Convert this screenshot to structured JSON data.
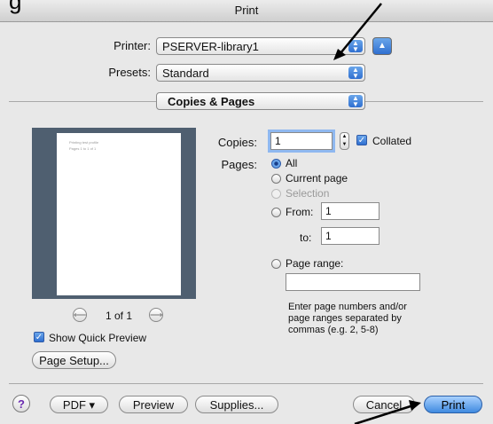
{
  "window": {
    "title": "Print",
    "title_fragment": "g"
  },
  "printer": {
    "label": "Printer:",
    "value": "PSERVER-library1"
  },
  "presets": {
    "label": "Presets:",
    "value": "Standard"
  },
  "section": {
    "value": "Copies & Pages"
  },
  "preview": {
    "page_lines": [
      "Printing test profile",
      "Pages 1 to 1 of 1"
    ],
    "nav_text": "1 of 1",
    "show_quick_preview_label": "Show Quick Preview"
  },
  "copies": {
    "label": "Copies:",
    "value": "1",
    "collated_label": "Collated"
  },
  "pages": {
    "label": "Pages:",
    "all": "All",
    "current": "Current page",
    "selection": "Selection",
    "from_label": "From:",
    "from_value": "1",
    "to_label": "to:",
    "to_value": "1",
    "range_label": "Page range:",
    "range_value": "",
    "hint": [
      "Enter page numbers and/or",
      "page ranges separated by",
      "commas (e.g. 2, 5-8)"
    ]
  },
  "buttons": {
    "page_setup": "Page Setup...",
    "help": "?",
    "pdf": "PDF ▾",
    "preview": "Preview",
    "supplies": "Supplies...",
    "cancel": "Cancel",
    "print": "Print"
  }
}
